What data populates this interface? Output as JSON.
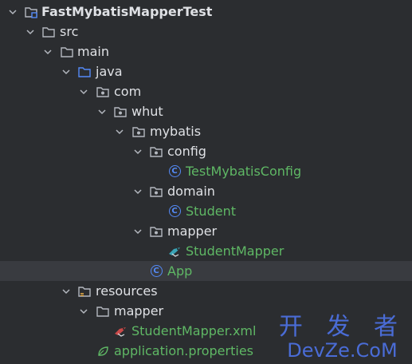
{
  "tree": {
    "root_label": "FastMybatisMapperTest",
    "src": "src",
    "main": "main",
    "java": "java",
    "com": "com",
    "whut": "whut",
    "mybatis": "mybatis",
    "config": "config",
    "test_mybatis_config": "TestMybatisConfig",
    "domain": "domain",
    "student": "Student",
    "mapper_pkg": "mapper",
    "student_mapper": "StudentMapper",
    "app": "App",
    "resources": "resources",
    "mapper_res": "mapper",
    "student_mapper_xml": "StudentMapper.xml",
    "application_properties": "application.properties"
  },
  "watermark": {
    "line1": "开 发 者",
    "line2": "DevZe.CoM"
  },
  "colors": {
    "background": "#2b2d30",
    "selected_row": "#393b40",
    "text": "#dfe1e5",
    "green_text": "#5fb865",
    "class_icon": "#548af7",
    "source_folder": "#548af7"
  }
}
